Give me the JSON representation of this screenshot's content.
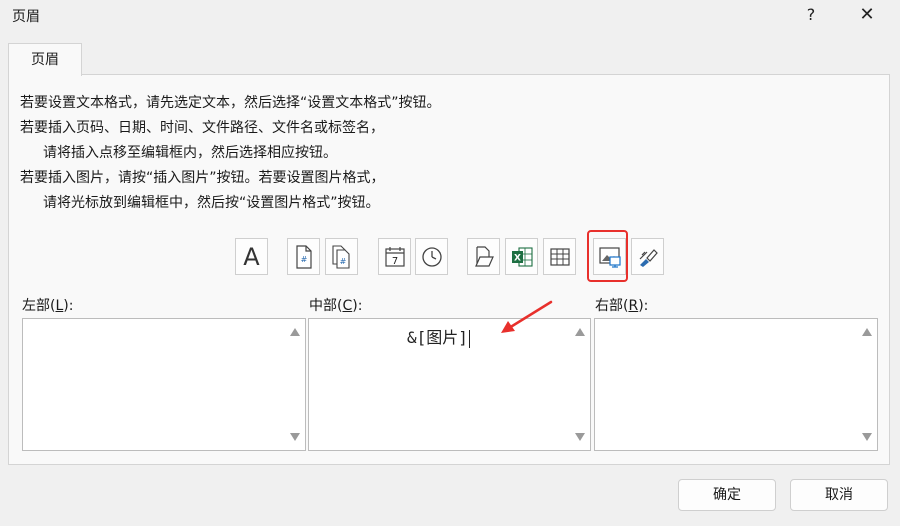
{
  "window": {
    "title": "页眉",
    "help_label": "?",
    "close_label": "✕"
  },
  "tab": {
    "label": "页眉"
  },
  "instructions": [
    "若要设置文本格式，请先选定文本，然后选择“设置文本格式”按钮。",
    "若要插入页码、日期、时间、文件路径、文件名或标签名，",
    "请将插入点移至编辑框内，然后选择相应按钮。",
    "若要插入图片，请按“插入图片”按钮。若要设置图片格式，",
    "请将光标放到编辑框中，然后按“设置图片格式”按钮。"
  ],
  "toolbar": {
    "icons": [
      "format-text-icon",
      "insert-page-number-icon",
      "insert-page-count-icon",
      "insert-date-icon",
      "insert-time-icon",
      "insert-file-path-icon",
      "insert-file-name-icon",
      "insert-sheet-name-icon",
      "insert-picture-icon",
      "format-picture-icon"
    ],
    "font_glyph": "A",
    "date_glyph": "7",
    "highlight_color": "#e8302c"
  },
  "sections": {
    "left": {
      "label_prefix": "左部(",
      "accel": "L",
      "label_suffix": "):",
      "content": ""
    },
    "center": {
      "label_prefix": "中部(",
      "accel": "C",
      "label_suffix": "):",
      "content": "&[图片]"
    },
    "right": {
      "label_prefix": "右部(",
      "accel": "R",
      "label_suffix": "):",
      "content": ""
    }
  },
  "buttons": {
    "ok": "确定",
    "cancel": "取消"
  },
  "annotation": {
    "arrow_color": "#e8302c"
  }
}
